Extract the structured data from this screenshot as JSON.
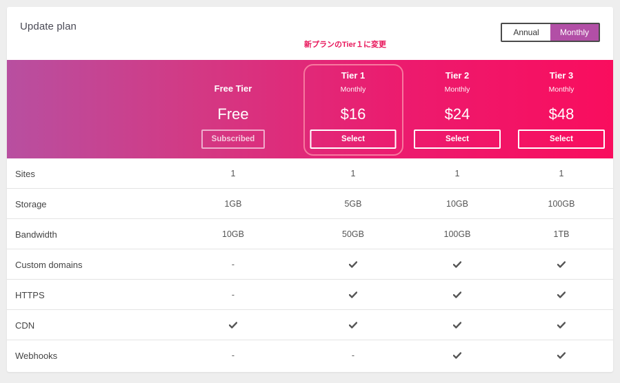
{
  "header": {
    "title": "Update plan",
    "toggle": {
      "options": [
        "Annual",
        "Monthly"
      ],
      "selected": "Monthly"
    },
    "annotation": "新プランのTier１に変更"
  },
  "plans": [
    {
      "name": "Free Tier",
      "period": "",
      "price": "Free",
      "button": "Subscribed"
    },
    {
      "name": "Tier 1",
      "period": "Monthly",
      "price": "$16",
      "button": "Select"
    },
    {
      "name": "Tier 2",
      "period": "Monthly",
      "price": "$24",
      "button": "Select"
    },
    {
      "name": "Tier 3",
      "period": "Monthly",
      "price": "$48",
      "button": "Select"
    }
  ],
  "features": [
    {
      "label": "Sites",
      "values": [
        "1",
        "1",
        "1",
        "1"
      ]
    },
    {
      "label": "Storage",
      "values": [
        "1GB",
        "5GB",
        "10GB",
        "100GB"
      ]
    },
    {
      "label": "Bandwidth",
      "values": [
        "10GB",
        "50GB",
        "100GB",
        "1TB"
      ]
    },
    {
      "label": "Custom domains",
      "values": [
        "-",
        "check",
        "check",
        "check"
      ]
    },
    {
      "label": "HTTPS",
      "values": [
        "-",
        "check",
        "check",
        "check"
      ]
    },
    {
      "label": "CDN",
      "values": [
        "check",
        "check",
        "check",
        "check"
      ]
    },
    {
      "label": "Webhooks",
      "values": [
        "-",
        "-",
        "check",
        "check"
      ]
    }
  ],
  "icons": {
    "check": "check-icon"
  },
  "colors": {
    "accent": "#b24fa6",
    "gradient_start": "#b84fa0",
    "gradient_end": "#f90d5e",
    "annotation": "#e8155a",
    "highlight": "#f7799f"
  }
}
